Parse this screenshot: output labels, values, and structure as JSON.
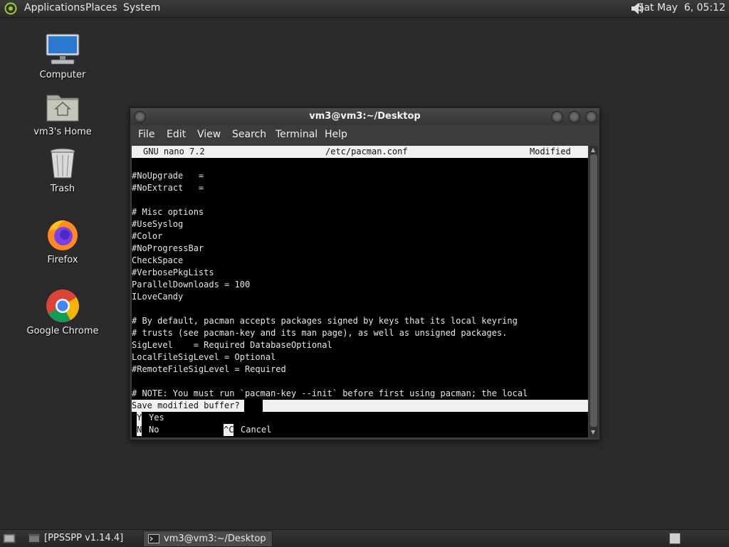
{
  "top_panel": {
    "menus": [
      "Applications",
      "Places",
      "System"
    ],
    "clock": "Sat May  6, 05:12"
  },
  "desktop_icons": [
    {
      "label": "Computer",
      "icon": "computer-icon"
    },
    {
      "label": "vm3's Home",
      "icon": "home-folder-icon"
    },
    {
      "label": "Trash",
      "icon": "trash-icon"
    },
    {
      "label": "Firefox",
      "icon": "firefox-icon"
    },
    {
      "label": "Google Chrome",
      "icon": "chrome-icon"
    }
  ],
  "window": {
    "title": "vm3@vm3:~/Desktop",
    "menus": [
      "File",
      "Edit",
      "View",
      "Search",
      "Terminal",
      "Help"
    ]
  },
  "nano": {
    "version": "GNU nano 7.2",
    "file": "/etc/pacman.conf",
    "status": "Modified",
    "lines": [
      "#NoUpgrade   =",
      "#NoExtract   =",
      "",
      "# Misc options",
      "#UseSyslog",
      "#Color",
      "#NoProgressBar",
      "CheckSpace",
      "#VerbosePkgLists",
      "ParallelDownloads = 100",
      "ILoveCandy",
      "",
      "# By default, pacman accepts packages signed by keys that its local keyring",
      "# trusts (see pacman-key and its man page), as well as unsigned packages.",
      "SigLevel    = Required DatabaseOptional",
      "LocalFileSigLevel = Optional",
      "#RemoteFileSigLevel = Required",
      "",
      "# NOTE: You must run `pacman-key --init` before first using pacman; the local"
    ],
    "prompt": "Save modified buffer?",
    "options": [
      {
        "key": "Y",
        "label": "Yes"
      },
      {
        "key": "N",
        "label": "No"
      },
      {
        "key": "^C",
        "label": "Cancel"
      }
    ]
  },
  "taskbar": {
    "tasks": [
      {
        "label": "[PPSSPP v1.14.4]",
        "active": false
      },
      {
        "label": "vm3@vm3:~/Desktop",
        "active": true
      }
    ]
  },
  "colors": {
    "desktop_bg": "#2b2b2b",
    "terminal_bg": "#000000",
    "terminal_fg": "#e6e6e6",
    "nano_bar": "#f0f0f0"
  }
}
